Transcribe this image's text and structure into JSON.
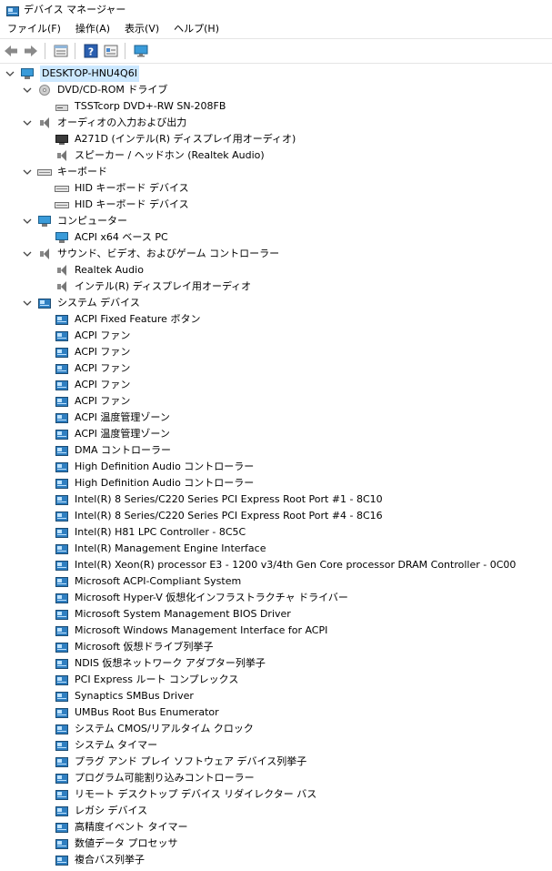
{
  "window": {
    "title": "デバイス マネージャー",
    "menu": [
      "ファイル(F)",
      "操作(A)",
      "表示(V)",
      "ヘルプ(H)"
    ],
    "toolbar_icons": [
      "back-arrow-icon",
      "forward-arrow-icon",
      "properties-icon",
      "help-icon",
      "view-icon",
      "monitor-icon"
    ]
  },
  "tree": {
    "root": "DESKTOP-HNU4Q6I",
    "categories": [
      {
        "label": "DVD/CD-ROM ドライブ",
        "icon": "disc-icon",
        "items": [
          {
            "label": "TSSTcorp DVD+-RW SN-208FB",
            "icon": "drive-icon"
          }
        ]
      },
      {
        "label": "オーディオの入力および出力",
        "icon": "speaker-icon",
        "items": [
          {
            "label": "A271D (インテル(R) ディスプレイ用オーディオ)",
            "icon": "monitor-icon"
          },
          {
            "label": "スピーカー / ヘッドホン (Realtek Audio)",
            "icon": "speaker-icon"
          }
        ]
      },
      {
        "label": "キーボード",
        "icon": "keyboard-icon",
        "items": [
          {
            "label": "HID キーボード デバイス",
            "icon": "keyboard-icon"
          },
          {
            "label": "HID キーボード デバイス",
            "icon": "keyboard-icon"
          }
        ]
      },
      {
        "label": "コンピューター",
        "icon": "computer-icon",
        "items": [
          {
            "label": "ACPI x64 ベース PC",
            "icon": "computer-icon"
          }
        ]
      },
      {
        "label": "サウンド、ビデオ、およびゲーム コントローラー",
        "icon": "speaker-icon",
        "items": [
          {
            "label": "Realtek Audio",
            "icon": "speaker-icon"
          },
          {
            "label": "インテル(R) ディスプレイ用オーディオ",
            "icon": "speaker-icon"
          }
        ]
      },
      {
        "label": "システム デバイス",
        "icon": "system-device-icon",
        "items": [
          {
            "label": "ACPI Fixed Feature ボタン",
            "icon": "system-device-icon"
          },
          {
            "label": "ACPI ファン",
            "icon": "system-device-icon"
          },
          {
            "label": "ACPI ファン",
            "icon": "system-device-icon"
          },
          {
            "label": "ACPI ファン",
            "icon": "system-device-icon"
          },
          {
            "label": "ACPI ファン",
            "icon": "system-device-icon"
          },
          {
            "label": "ACPI ファン",
            "icon": "system-device-icon"
          },
          {
            "label": "ACPI 温度管理ゾーン",
            "icon": "system-device-icon"
          },
          {
            "label": "ACPI 温度管理ゾーン",
            "icon": "system-device-icon"
          },
          {
            "label": "DMA コントローラー",
            "icon": "system-device-icon"
          },
          {
            "label": "High Definition Audio コントローラー",
            "icon": "system-device-icon"
          },
          {
            "label": "High Definition Audio コントローラー",
            "icon": "system-device-icon"
          },
          {
            "label": "Intel(R) 8 Series/C220 Series PCI Express Root Port #1 - 8C10",
            "icon": "system-device-icon"
          },
          {
            "label": "Intel(R) 8 Series/C220 Series PCI Express Root Port #4 - 8C16",
            "icon": "system-device-icon"
          },
          {
            "label": "Intel(R) H81 LPC Controller - 8C5C",
            "icon": "system-device-icon"
          },
          {
            "label": "Intel(R) Management Engine Interface",
            "icon": "system-device-icon"
          },
          {
            "label": "Intel(R) Xeon(R) processor E3 - 1200 v3/4th Gen Core processor DRAM Controller - 0C00",
            "icon": "system-device-icon"
          },
          {
            "label": "Microsoft ACPI-Compliant System",
            "icon": "system-device-icon"
          },
          {
            "label": "Microsoft Hyper-V 仮想化インフラストラクチャ ドライバー",
            "icon": "system-device-icon"
          },
          {
            "label": "Microsoft System Management BIOS Driver",
            "icon": "system-device-icon"
          },
          {
            "label": "Microsoft Windows Management Interface for ACPI",
            "icon": "system-device-icon"
          },
          {
            "label": "Microsoft 仮想ドライブ列挙子",
            "icon": "system-device-icon"
          },
          {
            "label": "NDIS 仮想ネットワーク アダプター列挙子",
            "icon": "system-device-icon"
          },
          {
            "label": "PCI Express ルート コンプレックス",
            "icon": "system-device-icon"
          },
          {
            "label": "Synaptics SMBus Driver",
            "icon": "system-device-icon"
          },
          {
            "label": "UMBus Root Bus Enumerator",
            "icon": "system-device-icon"
          },
          {
            "label": "システム CMOS/リアルタイム クロック",
            "icon": "system-device-icon"
          },
          {
            "label": "システム タイマー",
            "icon": "system-device-icon"
          },
          {
            "label": "プラグ アンド プレイ ソフトウェア デバイス列挙子",
            "icon": "system-device-icon"
          },
          {
            "label": "プログラム可能割り込みコントローラー",
            "icon": "system-device-icon"
          },
          {
            "label": "リモート デスクトップ デバイス リダイレクター バス",
            "icon": "system-device-icon"
          },
          {
            "label": "レガシ デバイス",
            "icon": "system-device-icon"
          },
          {
            "label": "高精度イベント タイマー",
            "icon": "system-device-icon"
          },
          {
            "label": "数値データ プロセッサ",
            "icon": "system-device-icon"
          },
          {
            "label": "複合バス列挙子",
            "icon": "system-device-icon"
          }
        ]
      }
    ]
  }
}
